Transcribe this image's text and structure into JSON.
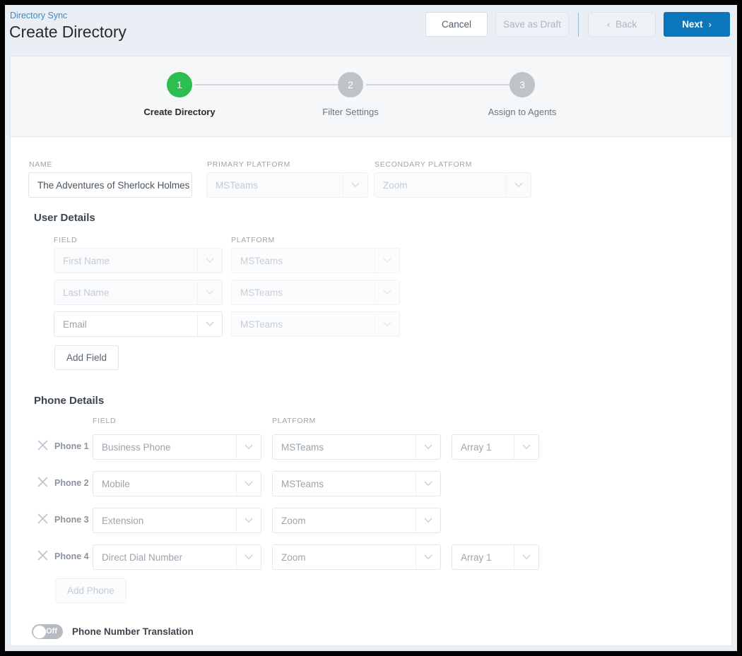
{
  "header": {
    "breadcrumb": "Directory Sync",
    "title": "Create Directory",
    "buttons": {
      "cancel": "Cancel",
      "save_draft": "Save as Draft",
      "back": "Back",
      "next": "Next",
      "back_chevron": "‹",
      "next_chevron": "›"
    }
  },
  "stepper": {
    "steps": [
      {
        "number": "1",
        "label": "Create Directory",
        "state": "active"
      },
      {
        "number": "2",
        "label": "Filter Settings",
        "state": "inactive"
      },
      {
        "number": "3",
        "label": "Assign to Agents",
        "state": "inactive"
      }
    ]
  },
  "top_fields": {
    "name": {
      "label": "NAME",
      "value": "The Adventures of Sherlock Holmes"
    },
    "primary_platform": {
      "label": "PRIMARY PLATFORM",
      "value": "MSTeams"
    },
    "secondary_platform": {
      "label": "SECONDARY PLATFORM",
      "value": "Zoom"
    }
  },
  "user_details": {
    "title": "User Details",
    "col_field": "FIELD",
    "col_platform": "PLATFORM",
    "rows": [
      {
        "field": "First Name",
        "platform": "MSTeams"
      },
      {
        "field": "Last Name",
        "platform": "MSTeams"
      },
      {
        "field": "Email",
        "platform": "MSTeams"
      }
    ],
    "add_button": "Add Field"
  },
  "phone_details": {
    "title": "Phone Details",
    "col_field": "FIELD",
    "col_platform": "PLATFORM",
    "rows": [
      {
        "label": "Phone 1",
        "field": "Business Phone",
        "platform": "MSTeams",
        "array": "Array 1"
      },
      {
        "label": "Phone 2",
        "field": "Mobile",
        "platform": "MSTeams",
        "array": ""
      },
      {
        "label": "Phone 3",
        "field": "Extension",
        "platform": "Zoom",
        "array": ""
      },
      {
        "label": "Phone 4",
        "field": "Direct Dial Number",
        "platform": "Zoom",
        "array": "Array 1"
      }
    ],
    "add_button": "Add Phone",
    "remove_icon": "✕"
  },
  "translation_toggle": {
    "state": "Off",
    "label": "Phone Number Translation"
  },
  "colors": {
    "primary_button": "#0b76bc",
    "step_active": "#2cbe4e",
    "step_inactive": "#bdc3c7",
    "link": "#3f88c5",
    "header_bg": "#e9eff5"
  }
}
